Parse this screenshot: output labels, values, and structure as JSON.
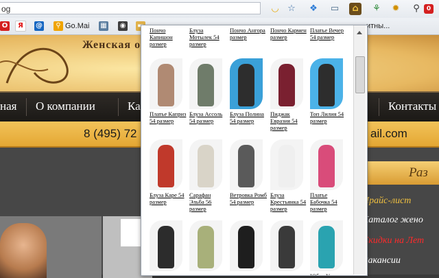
{
  "browser": {
    "url_fragment": "og",
    "bookmarks": [
      {
        "label": "",
        "icon": "opera-icon"
      },
      {
        "label": "",
        "icon": "yandex-icon"
      },
      {
        "label": "",
        "icon": "mail-at-icon"
      },
      {
        "label": "Go.Mai",
        "icon": "search-pin-icon"
      },
      {
        "label": "",
        "icon": "vk-icon"
      },
      {
        "label": "",
        "icon": "camera-icon"
      },
      {
        "label": "",
        "icon": "folder-icon"
      },
      {
        "label": "итны...",
        "icon": ""
      }
    ],
    "extension_badge": "0"
  },
  "site": {
    "tagline": "Женская о",
    "nav": [
      "ная",
      "О компании",
      "Ка",
      "Контакты"
    ],
    "phone": "8 (495) 72",
    "email": "ail.com",
    "right_title": "Раз",
    "right_links": [
      {
        "label": "Прайс-лист",
        "color": "#f0c040"
      },
      {
        "label": "Каталог жено",
        "color": "#ffffff"
      },
      {
        "label": "Скидки на Лет",
        "color": "#ff2a2a"
      },
      {
        "label": "Вакансии",
        "color": "#ffffff"
      }
    ]
  },
  "catalog_panel": {
    "rows": [
      [
        "Пончо Капишон размер",
        "Блуза Мотылек 54 размер",
        "Пончо Ангора размер",
        "Пончо Кармен размер",
        "Платье Вечер 54 размер"
      ],
      [
        "Платье Каприз 54 размер",
        "Блуза Ассоль 54 размер",
        "Блуза Полина 54 размер",
        "Пиджак Евразия 54 размер",
        "Топ Лилия 54 размер"
      ],
      [
        "Блуза Каре 54 размер",
        "Сарафан Эльба 56 размер",
        "Ветровка Ромб 54 размер",
        "Блуза Крестьянка 54 размер",
        "Платье Бабочка 54 размер"
      ],
      [
        "",
        "",
        "",
        "",
        "Юбка Утка"
      ]
    ]
  }
}
